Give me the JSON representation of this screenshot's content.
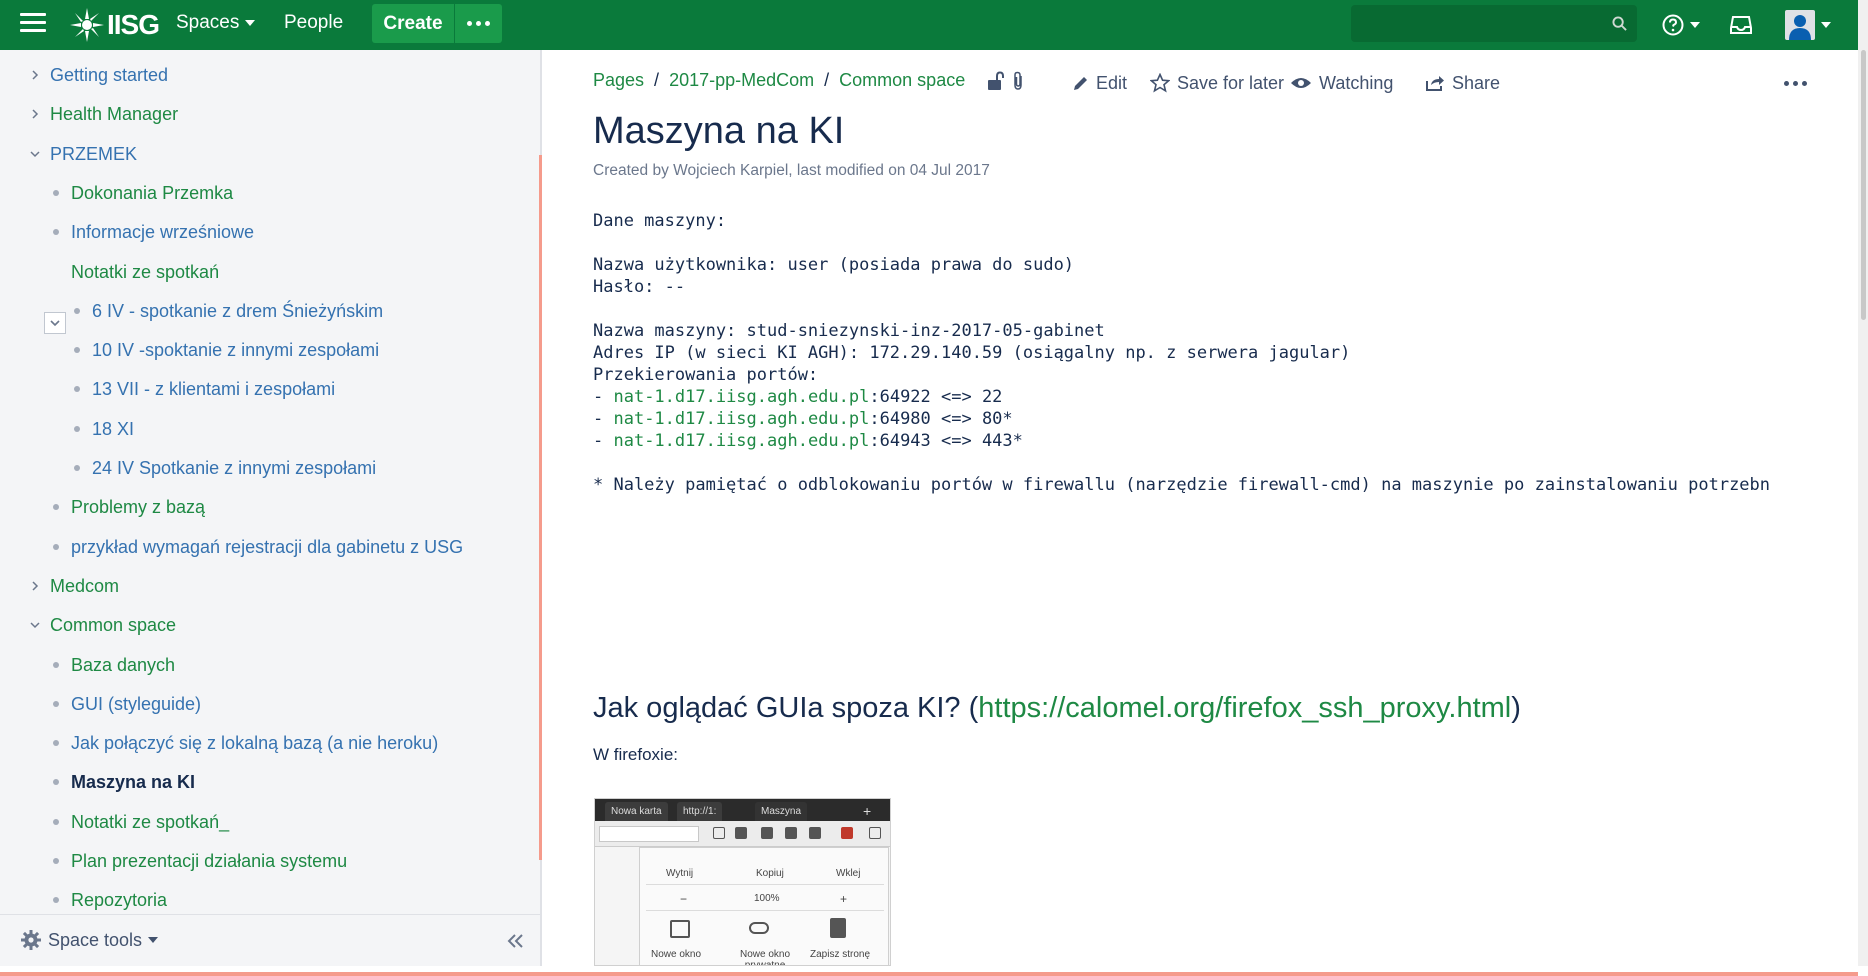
{
  "colors": {
    "nav_bg": "#0a7a3b",
    "create_bg": "#1a9b4b",
    "link_green": "#1e8944",
    "link_blue": "#3572b0",
    "text_dark": "#172b4d",
    "meta_gray": "#6b778c",
    "sidebar_bg": "#f4f5f7"
  },
  "nav": {
    "logo_text": "IISG",
    "spaces_label": "Spaces",
    "people_label": "People",
    "create_label": "Create",
    "search_placeholder": "",
    "icons": [
      "menu-icon",
      "more-icon",
      "search-icon",
      "help-icon",
      "notifications-icon",
      "user-avatar-icon"
    ]
  },
  "sidebar": {
    "items": [
      {
        "label": "Getting started",
        "kind": "collapsed",
        "depth": 0,
        "color": "blue"
      },
      {
        "label": "Health Manager",
        "kind": "collapsed",
        "depth": 0,
        "color": "green"
      },
      {
        "label": "PRZEMEK",
        "kind": "expanded",
        "depth": 0,
        "color": "blue"
      },
      {
        "label": "Dokonania Przemka",
        "kind": "bullet",
        "depth": 1,
        "color": "green"
      },
      {
        "label": "Informacje wrześniowe",
        "kind": "bullet",
        "depth": 1,
        "color": "blue"
      },
      {
        "label": "Notatki ze spotkań",
        "kind": "expanded-box",
        "depth": 1,
        "color": "green"
      },
      {
        "label": "6 IV - spotkanie z drem Śnieżyńskim",
        "kind": "bullet",
        "depth": 2,
        "color": "blue"
      },
      {
        "label": "10 IV -spoktanie z innymi zespołami",
        "kind": "bullet",
        "depth": 2,
        "color": "blue"
      },
      {
        "label": "13 VII - z klientami i zespołami",
        "kind": "bullet",
        "depth": 2,
        "color": "blue"
      },
      {
        "label": "18 XI",
        "kind": "bullet",
        "depth": 2,
        "color": "blue"
      },
      {
        "label": "24 IV Spotkanie z innymi zespołami",
        "kind": "bullet",
        "depth": 2,
        "color": "blue"
      },
      {
        "label": "Problemy z bazą",
        "kind": "bullet",
        "depth": 1,
        "color": "green"
      },
      {
        "label": "przykład wymagań rejestracji dla gabinetu z USG",
        "kind": "bullet",
        "depth": 1,
        "color": "blue"
      },
      {
        "label": "Medcom",
        "kind": "collapsed",
        "depth": 0,
        "color": "green"
      },
      {
        "label": "Common space",
        "kind": "expanded",
        "depth": 0,
        "color": "green"
      },
      {
        "label": "Baza danych",
        "kind": "bullet",
        "depth": 1,
        "color": "green"
      },
      {
        "label": "GUI (styleguide)",
        "kind": "bullet",
        "depth": 1,
        "color": "blue"
      },
      {
        "label": "Jak połączyć się z lokalną bazą (a nie heroku)",
        "kind": "bullet",
        "depth": 1,
        "color": "blue"
      },
      {
        "label": "Maszyna na KI",
        "kind": "bullet-current",
        "depth": 1,
        "color": "current"
      },
      {
        "label": "Notatki ze spotkań_",
        "kind": "bullet",
        "depth": 1,
        "color": "green"
      },
      {
        "label": "Plan prezentacji działania systemu",
        "kind": "bullet",
        "depth": 1,
        "color": "green"
      },
      {
        "label": "Repozytoria",
        "kind": "bullet",
        "depth": 1,
        "color": "green"
      }
    ],
    "space_tools_label": "Space tools"
  },
  "page": {
    "breadcrumbs": [
      "Pages",
      "2017-pp-MedCom",
      "Common space"
    ],
    "actions": {
      "edit": "Edit",
      "save_for_later": "Save for later",
      "watching": "Watching",
      "share": "Share"
    },
    "title": "Maszyna na KI",
    "meta": "Created by Wojciech Karpiel, last modified on 04 Jul 2017",
    "code": {
      "line1": "Dane maszyny:",
      "line2": "",
      "line3": "Nazwa użytkownika: user (posiada prawa do sudo)",
      "line4": "Hasło: --",
      "line5": "",
      "line6": "Nazwa maszyny: stud-sniezynski-inz-2017-05-gabinet",
      "line7": "Adres IP (w sieci KI AGH): 172.29.140.59 (osiągalny np. z serwera jagular)",
      "line8": "Przekierowania portów:",
      "ports": [
        {
          "prefix": "- ",
          "host": "nat-1.d17.iisg.agh.edu.pl",
          "rest": ":64922 <=> 22"
        },
        {
          "prefix": "- ",
          "host": "nat-1.d17.iisg.agh.edu.pl",
          "rest": ":64980 <=> 80*"
        },
        {
          "prefix": "- ",
          "host": "nat-1.d17.iisg.agh.edu.pl",
          "rest": ":64943 <=> 443*"
        }
      ],
      "note": "* Należy pamiętać o odblokowaniu portów w firewallu (narzędzie firewall-cmd) na maszynie po zainstalowaniu potrzebn"
    },
    "section": {
      "heading_prefix": "Jak oglądać GUIa spoza KI? (",
      "heading_link": "https://calomel.org/firefox_ssh_proxy.html",
      "heading_suffix": ")",
      "paragraph": "W firefoxie:"
    },
    "screenshot": {
      "tab1": "Nowa karta",
      "tab2": "http://1:",
      "tab3": "Maszyna",
      "cut": "Wytnij",
      "copy": "Kopiuj",
      "paste": "Wklej",
      "zoom_minus": "−",
      "zoom": "100%",
      "zoom_plus": "+",
      "new_window": "Nowe okno",
      "private_window": "Nowe okno prywatne",
      "save_page": "Zapisz stronę"
    }
  }
}
